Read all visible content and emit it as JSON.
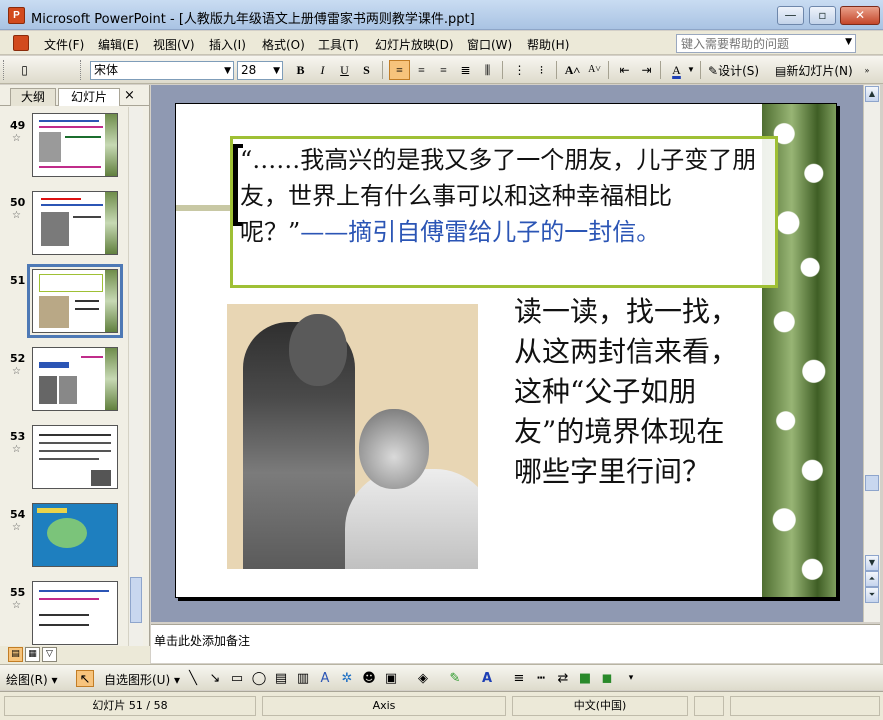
{
  "window": {
    "title": "Microsoft PowerPoint - [人教版九年级语文上册傅雷家书两则教学课件.ppt]",
    "app_icon_label": "P",
    "minimize": "—",
    "restore": "▫",
    "close": "✕"
  },
  "menu": {
    "items": [
      "文件(F)",
      "编辑(E)",
      "视图(V)",
      "插入(I)",
      "格式(O)",
      "工具(T)",
      "幻灯片放映(D)",
      "窗口(W)",
      "帮助(H)"
    ],
    "help_placeholder": "键入需要帮助的问题"
  },
  "toolbar": {
    "font_name": "宋体",
    "font_size": "28",
    "bold": "B",
    "italic": "I",
    "underline": "U",
    "shadow": "S",
    "design": "设计(S)",
    "new_slide": "新幻灯片(N)"
  },
  "left_panel": {
    "tabs": [
      "大纲",
      "幻灯片"
    ],
    "close": "×",
    "slides": [
      {
        "number": "49",
        "star": "☆"
      },
      {
        "number": "50",
        "star": "☆"
      },
      {
        "number": "51",
        "star": ""
      },
      {
        "number": "52",
        "star": "☆"
      },
      {
        "number": "53",
        "star": "☆"
      },
      {
        "number": "54",
        "star": "☆"
      },
      {
        "number": "55",
        "star": "☆"
      }
    ],
    "selected_slide": "51"
  },
  "slide": {
    "quote": "“……我高兴的是我又多了一个朋友，儿子变了朋友，世界上有什么事可以和这种幸福相比呢？”",
    "quote_source": "——摘引自傅雷给儿子的一封信。",
    "question": "读一读，找一找，从这两封信来看，这种“父子如朋友”的境界体现在哪些字里行间？"
  },
  "notes": {
    "placeholder": "单击此处添加备注"
  },
  "drawing_toolbar": {
    "draw": "绘图(R)",
    "autoshapes": "自选图形(U)"
  },
  "status": {
    "slide_count": "幻灯片 51 / 58",
    "theme": "Axis",
    "language": "中文(中国)"
  },
  "colors": {
    "quote_border": "#9fc035",
    "quote_source": "#2b55b5",
    "selection_frame": "#4e79b5"
  }
}
